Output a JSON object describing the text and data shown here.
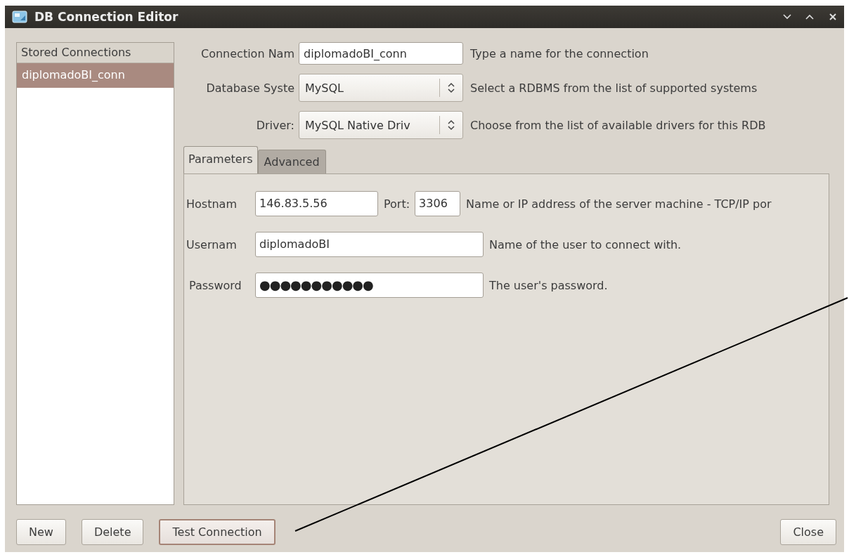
{
  "window": {
    "title": "DB Connection Editor"
  },
  "stored_connections": {
    "header": "Stored Connections",
    "items": [
      {
        "label": "diplomadoBI_conn",
        "selected": true
      }
    ]
  },
  "form": [
    {
      "kind": "text",
      "label": "Connection Nam",
      "value": "diplomadoBI_conn",
      "description": "Type a name for the connection"
    },
    {
      "kind": "combo",
      "label": "Database Syste",
      "value": "MySQL",
      "description": "Select a RDBMS from the list of supported systems"
    },
    {
      "kind": "combo",
      "label": "Driver:",
      "value": "MySQL Native Driv",
      "description": "Choose from the list of available drivers for this RDB"
    }
  ],
  "tabs": [
    {
      "label": "Parameters",
      "selected": true
    },
    {
      "label": "Advanced",
      "selected": false
    }
  ],
  "parameters": {
    "hostname": {
      "label": "Hostnam",
      "value": "146.83.5.56"
    },
    "port": {
      "label": "Port:",
      "value": "3306"
    },
    "hostname_description": "Name or IP address of the server machine - TCP/IP por",
    "username": {
      "label": "Usernam",
      "value": "diplomadoBI",
      "description": "Name of the user to connect with."
    },
    "password": {
      "label": "Password",
      "value": "●●●●●●●●●●●",
      "description": "The user's password."
    }
  },
  "buttons": [
    {
      "label": "New",
      "focused": false
    },
    {
      "label": "Delete",
      "focused": false
    },
    {
      "label": "Test Connection",
      "focused": true
    }
  ],
  "close_button": "Close"
}
